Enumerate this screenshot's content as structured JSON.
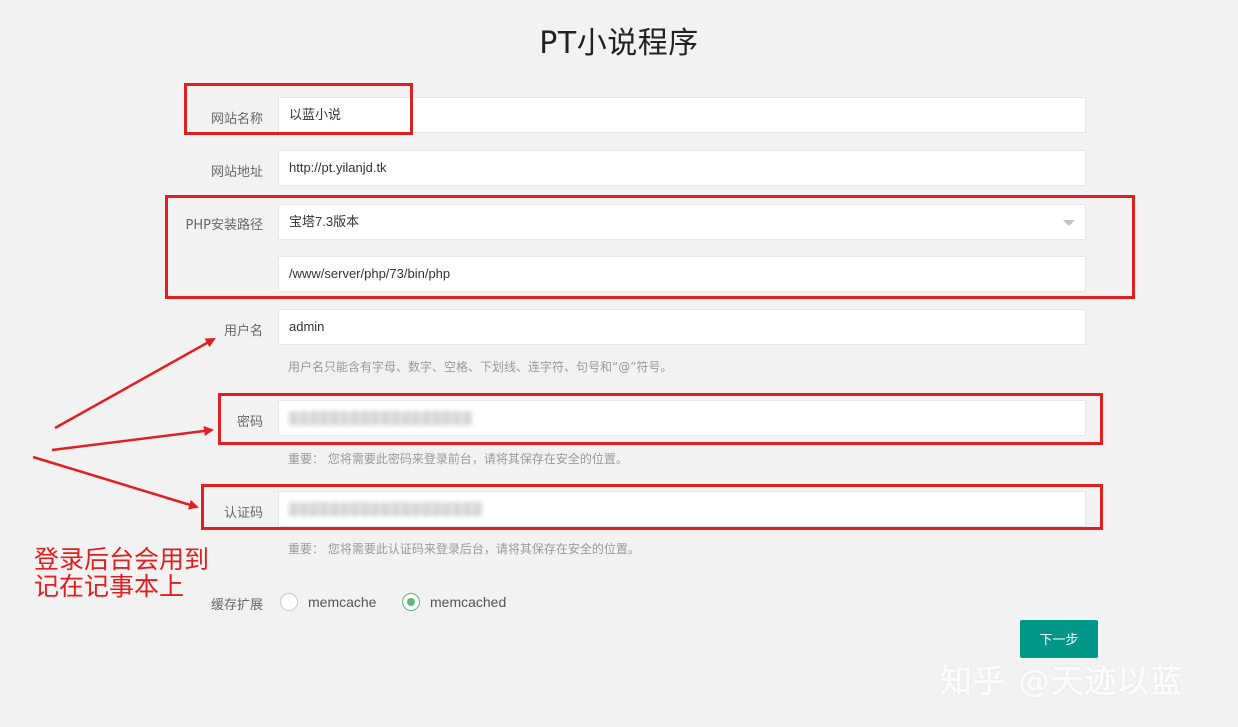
{
  "page": {
    "title": "PT小说程序"
  },
  "form": {
    "site_name": {
      "label": "网站名称",
      "value": "以蓝小说"
    },
    "site_url": {
      "label": "网站地址",
      "value": "http://pt.yilanjd.tk"
    },
    "php_path": {
      "label": "PHP安装路径",
      "selected": "宝塔7.3版本",
      "path_value": "/www/server/php/73/bin/php"
    },
    "username": {
      "label": "用户名",
      "value": "admin",
      "hint": "用户名只能含有字母、数字、空格、下划线、连字符、句号和“@”符号。"
    },
    "password": {
      "label": "密码",
      "hint": "重要： 您将需要此密码来登录前台，请将其保存在安全的位置。"
    },
    "auth_code": {
      "label": "认证码",
      "hint": "重要： 您将需要此认证码来登录后台，请将其保存在安全的位置。"
    },
    "cache": {
      "label": "缓存扩展",
      "options": [
        {
          "label": "memcache",
          "checked": false
        },
        {
          "label": "memcached",
          "checked": true
        }
      ]
    },
    "next_button": "下一步"
  },
  "annotation": {
    "line1": "登录后台会用到",
    "line2": "记在记事本上"
  },
  "watermark": "知乎 @天迹以蓝",
  "colors": {
    "accent": "#009688",
    "annotation_red": "#e02020",
    "radio_green": "#5fb878"
  }
}
